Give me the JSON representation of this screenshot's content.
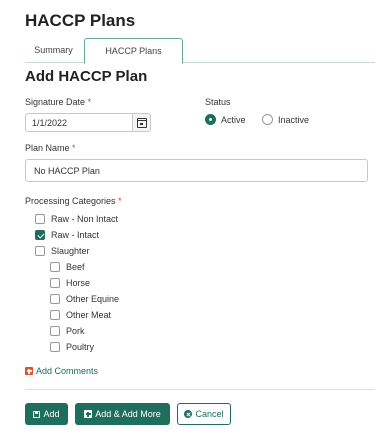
{
  "page": {
    "title": "HACCP Plans"
  },
  "tabs": [
    {
      "label": "Summary",
      "active": false
    },
    {
      "label": "HACCP Plans",
      "active": true
    }
  ],
  "form": {
    "title": "Add HACCP Plan",
    "signature_date": {
      "label": "Signature Date",
      "required_mark": "*",
      "value": "1/1/2022",
      "icon": "calendar-icon"
    },
    "status": {
      "label": "Status",
      "options": [
        {
          "label": "Active",
          "selected": true
        },
        {
          "label": "Inactive",
          "selected": false
        }
      ]
    },
    "plan_name": {
      "label": "Plan Name",
      "required_mark": "*",
      "value": "No HACCP Plan"
    },
    "processing_categories": {
      "label": "Processing Categories",
      "required_mark": "*",
      "items": [
        {
          "label": "Raw - Non Intact",
          "checked": false
        },
        {
          "label": "Raw - Intact",
          "checked": true
        },
        {
          "label": "Slaughter",
          "checked": false
        }
      ],
      "sub_items": [
        {
          "label": "Beef",
          "checked": false
        },
        {
          "label": "Horse",
          "checked": false
        },
        {
          "label": "Other Equine",
          "checked": false
        },
        {
          "label": "Other Meat",
          "checked": false
        },
        {
          "label": "Pork",
          "checked": false
        },
        {
          "label": "Poultry",
          "checked": false
        }
      ]
    },
    "add_comments": {
      "label": "Add Comments",
      "icon": "plus-square-icon"
    }
  },
  "actions": {
    "add": {
      "label": "Add",
      "icon": "save-icon"
    },
    "add_more": {
      "label": "Add & Add More",
      "icon": "plus-square-icon"
    },
    "cancel": {
      "label": "Cancel",
      "icon": "x-circle-icon"
    }
  },
  "colors": {
    "accent": "#1f6d5c",
    "required": "#d23c3c",
    "comment_icon": "#e2502c"
  }
}
